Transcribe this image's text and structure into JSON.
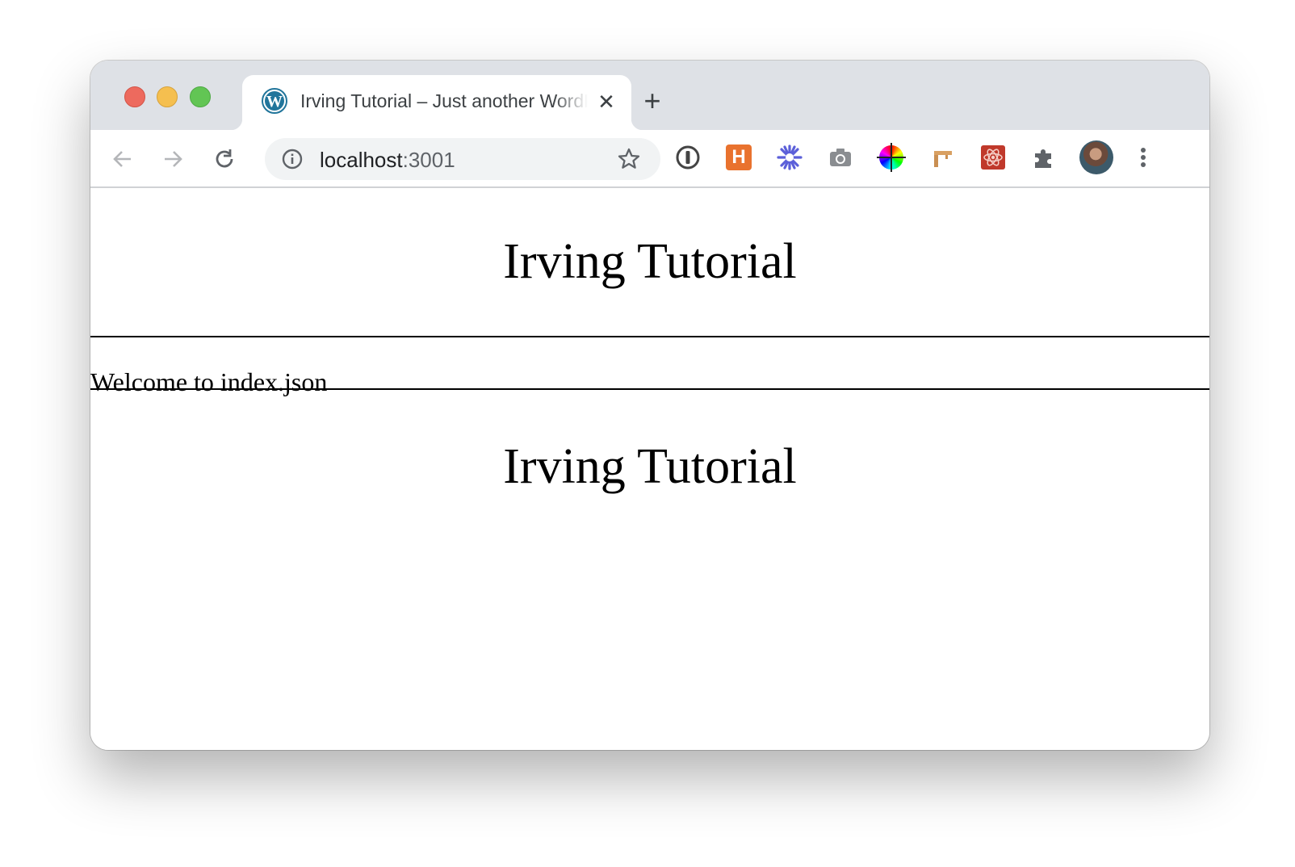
{
  "browser": {
    "tab": {
      "title": "Irving Tutorial – Just another WordPress site",
      "favicon": "wordpress-icon",
      "close_icon": "close-icon"
    },
    "new_tab_icon": "plus-icon",
    "toolbar": {
      "back_icon": "back-arrow-icon",
      "forward_icon": "forward-arrow-icon",
      "reload_icon": "reload-icon",
      "address": {
        "info_icon": "info-icon",
        "host": "localhost",
        "port": ":3001",
        "bookmark_icon": "star-icon"
      },
      "extensions": [
        "1password-icon",
        "h-extension-icon",
        "asterisk-extension-icon",
        "camera-icon",
        "color-wheel-icon",
        "signpost-icon",
        "react-devtools-icon",
        "puzzle-icon"
      ],
      "profile": "avatar",
      "menu_icon": "more-vert-icon"
    },
    "traffic_light_colors": [
      "#ed6a5e",
      "#f5bf4f",
      "#62c554"
    ]
  },
  "page": {
    "header_title": "Irving Tutorial",
    "welcome_text": "Welcome to index.json",
    "footer_title": "Irving Tutorial"
  }
}
